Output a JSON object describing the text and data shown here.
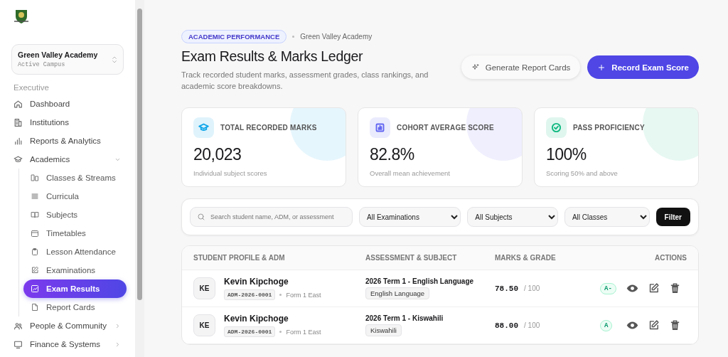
{
  "sidebar": {
    "campus": {
      "name": "Green Valley Academy",
      "subtitle": "Active Campus"
    },
    "section_label": "Executive",
    "items": [
      {
        "label": "Dashboard"
      },
      {
        "label": "Institutions"
      },
      {
        "label": "Reports & Analytics"
      },
      {
        "label": "Academics",
        "expanded": true,
        "children": [
          {
            "label": "Classes & Streams",
            "selected": false
          },
          {
            "label": "Curricula",
            "selected": false
          },
          {
            "label": "Subjects",
            "selected": false
          },
          {
            "label": "Timetables",
            "selected": false
          },
          {
            "label": "Lesson Attendance",
            "selected": false
          },
          {
            "label": "Examinations",
            "selected": false
          },
          {
            "label": "Exam Results",
            "selected": true
          },
          {
            "label": "Report Cards",
            "selected": false
          }
        ]
      },
      {
        "label": "People & Community",
        "expanded": false
      },
      {
        "label": "Finance & Systems",
        "expanded": false
      }
    ]
  },
  "header": {
    "badge": "ACADEMIC PERFORMANCE",
    "breadcrumb": "Green Valley Academy",
    "title": "Exam Results & Marks Ledger",
    "subtitle": "Track recorded student marks, assessment grades, class rankings, and academic score breakdowns.",
    "buttons": [
      {
        "label": "Generate Report Cards",
        "kind": "secondary"
      },
      {
        "label": "Record Exam Score",
        "kind": "primary"
      }
    ]
  },
  "stats": [
    {
      "label": "TOTAL RECORDED MARKS",
      "value": "20,023",
      "caption": "Individual subject scores",
      "color": "#0ea5e9"
    },
    {
      "label": "COHORT AVERAGE SCORE",
      "value": "82.8%",
      "caption": "Overall mean achievement",
      "color": "#6366f1"
    },
    {
      "label": "PASS PROFICIENCY",
      "value": "100%",
      "caption": "Scoring 50% and above",
      "color": "#10b981"
    }
  ],
  "filters": {
    "search": {
      "placeholder": "Search student name, ADM, or assessment"
    },
    "selects": [
      {
        "value": "All Examinations"
      },
      {
        "value": "All Subjects"
      },
      {
        "value": "All Classes"
      }
    ],
    "button": "Filter"
  },
  "table": {
    "columns": [
      "STUDENT PROFILE & ADM",
      "ASSESSMENT & SUBJECT",
      "MARKS & GRADE",
      "ACTIONS"
    ],
    "rows": [
      {
        "initials": "KE",
        "name": "Kevin Kipchoge",
        "adm": "ADM-2026-0001",
        "class": "Form 1 East",
        "assessment": "2026 Term 1 - English Language",
        "subject": "English Language",
        "marks": "78.50",
        "out_of": "/ 100",
        "grade": "A-"
      },
      {
        "initials": "KE",
        "name": "Kevin Kipchoge",
        "adm": "ADM-2026-0001",
        "class": "Form 1 East",
        "assessment": "2026 Term 1 - Kiswahili",
        "subject": "Kiswahili",
        "marks": "88.00",
        "out_of": "/ 100",
        "grade": "A"
      }
    ]
  }
}
